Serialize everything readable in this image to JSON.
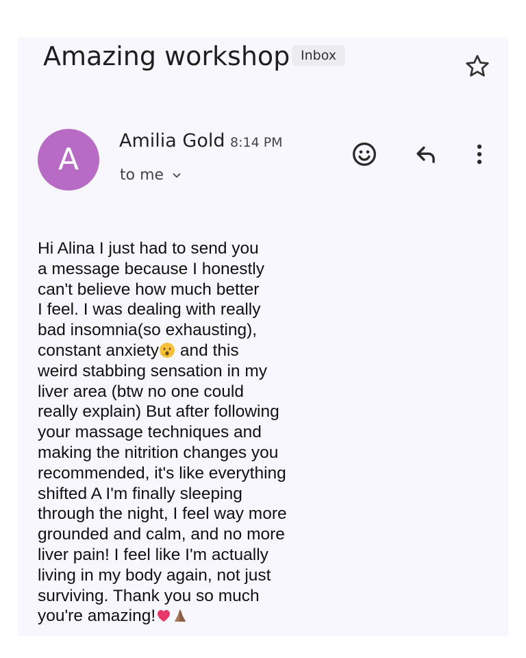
{
  "email": {
    "subject": "Amazing workshop",
    "label": "Inbox",
    "sender": {
      "initial": "A",
      "name": "Amilia Gold",
      "time": "8:14 PM",
      "recipient": "to me"
    },
    "body_lines": [
      "Hi Alina I just had to send you",
      "a message because I honestly",
      "can't believe how much better",
      "I feel. I was dealing with really",
      "bad insomnia(so exhausting),",
      "constant anxiety",
      " and this",
      "weird stabbing sensation in my",
      "liver area (btw no one could",
      "really explain) But after following",
      "your massage techniques and",
      "making the nitrition changes you",
      "recommended, it's like everything",
      "shifted A I'm finally sleeping",
      "through the night, I feel way more",
      "grounded and calm, and no more",
      "liver pain! I feel like I'm actually",
      "living in my body again, not just",
      "surviving. Thank you so much",
      "you're amazing!"
    ]
  },
  "icons": {
    "star": "star-outline-icon",
    "emoji_reaction": "smiley-icon",
    "reply": "reply-icon",
    "more": "more-vertical-icon",
    "chevron": "chevron-down-icon",
    "emoji_inline_1": "face-with-open-mouth-icon",
    "emoji_inline_2": "heart-icon",
    "emoji_inline_3": "folded-hands-icon"
  },
  "colors": {
    "avatar_bg": "#b86bc4",
    "card_bg": "#f8f7fd",
    "chip_bg": "#ecebf0"
  }
}
